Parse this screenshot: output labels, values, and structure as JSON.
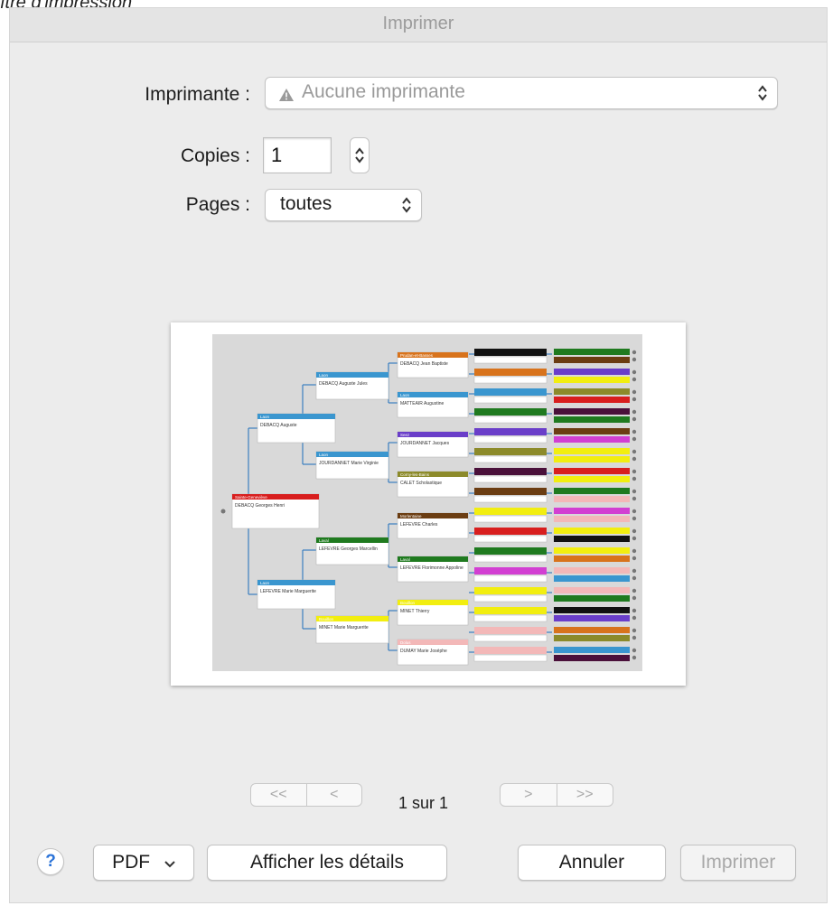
{
  "caption": "ître d'impression",
  "dialog": {
    "title": "Imprimer"
  },
  "printer": {
    "label": "Imprimante :",
    "value": "Aucune imprimante",
    "warning_icon": "warning-triangle-icon"
  },
  "copies": {
    "label": "Copies :",
    "value": "1"
  },
  "pages": {
    "label": "Pages :",
    "value": "toutes"
  },
  "pagination": {
    "first": "<<",
    "prev": "<",
    "next": ">",
    "last": ">>",
    "info": "1 sur 1"
  },
  "buttons": {
    "help": "?",
    "pdf": "PDF",
    "details": "Afficher les détails",
    "cancel": "Annuler",
    "print": "Imprimer"
  },
  "preview": {
    "colors": {
      "red": "#d81e1e",
      "blue": "#3a96cf",
      "green": "#1f7a1f",
      "orange": "#d8731c",
      "purple": "#6a3ec9",
      "olive": "#8c8a2a",
      "yellow": "#f2ee10",
      "pink": "#f3b8b8",
      "brown": "#6b3d12",
      "black": "#111111",
      "magenta": "#d23fd2",
      "darkpurple": "#4a103a"
    },
    "persons": [
      {
        "head": "Sainte-Geneviève",
        "name": "DEBACQ Georges Henri",
        "color": "red"
      },
      {
        "head": "Laon",
        "name": "DEBACQ Auguste",
        "color": "blue"
      },
      {
        "head": "Laon",
        "name": "LEFEVRE Marie Marguerite",
        "color": "blue"
      },
      {
        "head": "Laon",
        "name": "DEBACQ Auguste Jules",
        "color": "blue"
      },
      {
        "head": "Laon",
        "name": "JOURDANNET Marie Virginie",
        "color": "blue"
      },
      {
        "head": "Laval",
        "name": "LEFEVRE Georges Marcellin",
        "color": "green"
      },
      {
        "head": "Bouillon",
        "name": "MINET Marie Marguerite",
        "color": "yellow"
      },
      {
        "head": "Prudan-et-Basses",
        "name": "DEBACQ Jean Baptiste",
        "color": "orange"
      },
      {
        "head": "Laon",
        "name": "MATTEAIR Augustine",
        "color": "blue"
      },
      {
        "head": "Seez",
        "name": "JOURDANNET Jacques",
        "color": "purple"
      },
      {
        "head": "Corny-les-Bains",
        "name": "CALET Scholastique",
        "color": "olive"
      },
      {
        "head": "Morlentaine",
        "name": "LEFEVRE Charles",
        "color": "brown"
      },
      {
        "head": "Laval",
        "name": "LEFEVRE Florimonne Appoline",
        "color": "green"
      },
      {
        "head": "Bouillon",
        "name": "MINET Thierry",
        "color": "yellow"
      },
      {
        "head": "Dolus",
        "name": "DUMAY Marie Joséphe",
        "color": "pink"
      }
    ]
  }
}
